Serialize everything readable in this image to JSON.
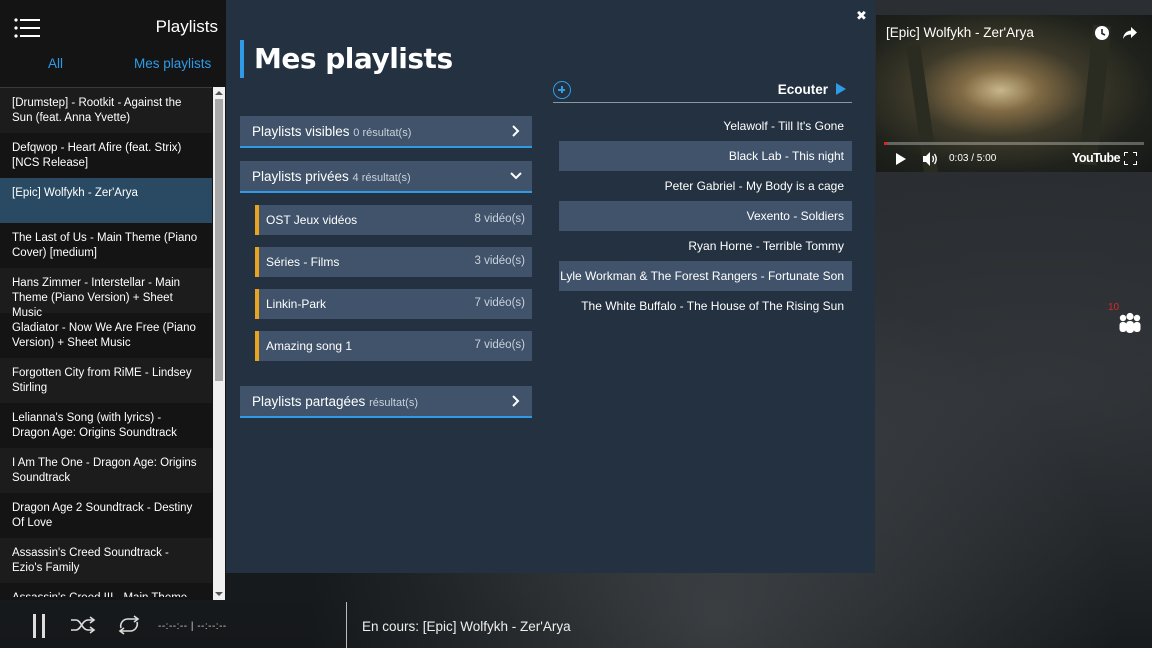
{
  "sidebar": {
    "title": "Playlists",
    "tabs": [
      "All",
      "Mes playlists"
    ],
    "items": [
      "[Drumstep] - Rootkit - Against the Sun (feat. Anna Yvette)",
      "Defqwop - Heart Afire (feat. Strix) [NCS Release]",
      "[Epic] Wolfykh - Zer'Arya",
      "The Last of Us - Main Theme (Piano Cover) [medium]",
      "Hans Zimmer - Interstellar - Main Theme (Piano Version) + Sheet Music",
      "Gladiator - Now We Are Free (Piano Version) + Sheet Music",
      "Forgotten City from RiME - Lindsey Stirling",
      "Lelianna's Song (with lyrics) - Dragon Age: Origins Soundtrack",
      "I Am The One - Dragon Age: Origins Soundtrack",
      "Dragon Age 2 Soundtrack - Destiny Of Love",
      "Assassin's Creed Soundtrack - Ezio's Family",
      "Assassin's Creed III - Main Theme"
    ],
    "active_index": 2
  },
  "panel": {
    "title": "Mes playlists",
    "groups": {
      "visible": {
        "label": "Playlists visibles",
        "count": "0 résultat(s)"
      },
      "private": {
        "label": "Playlists privées",
        "count": "4 résultat(s)"
      },
      "shared": {
        "label": "Playlists partagées",
        "count": "résultat(s)"
      }
    },
    "private_playlists": [
      {
        "name": "OST Jeux vidéos",
        "count": "8 vidéo(s)"
      },
      {
        "name": "Séries - Films",
        "count": "3 vidéo(s)"
      },
      {
        "name": "Linkin-Park",
        "count": "7 vidéo(s)"
      },
      {
        "name": "Amazing song 1",
        "count": "7 vidéo(s)"
      }
    ],
    "listen_label": "Ecouter",
    "songs": [
      "Yelawolf - Till It's Gone",
      "Black Lab - This night",
      "Peter Gabriel - My Body is a cage",
      "Vexento - Soldiers",
      "Ryan Horne - Terrible Tommy",
      "Lyle Workman & The Forest Rangers - Fortunate Son",
      "The White Buffalo - The House of The Rising Sun"
    ],
    "close_label": "✖"
  },
  "video": {
    "title": "[Epic] Wolfykh - Zer'Arya",
    "time": "0:03 / 5:00",
    "brand": "YouTube",
    "progress_fraction": 0.01
  },
  "friends": {
    "count": "10"
  },
  "player": {
    "time": "--:--:-- | --:--:--",
    "now_playing": "En cours: [Epic] Wolfykh - Zer'Arya"
  },
  "colors": {
    "accent": "#2f9be6",
    "playlist_marker": "#e8a31f",
    "panel_bg": "#233140",
    "row_bg": "#40536a"
  }
}
